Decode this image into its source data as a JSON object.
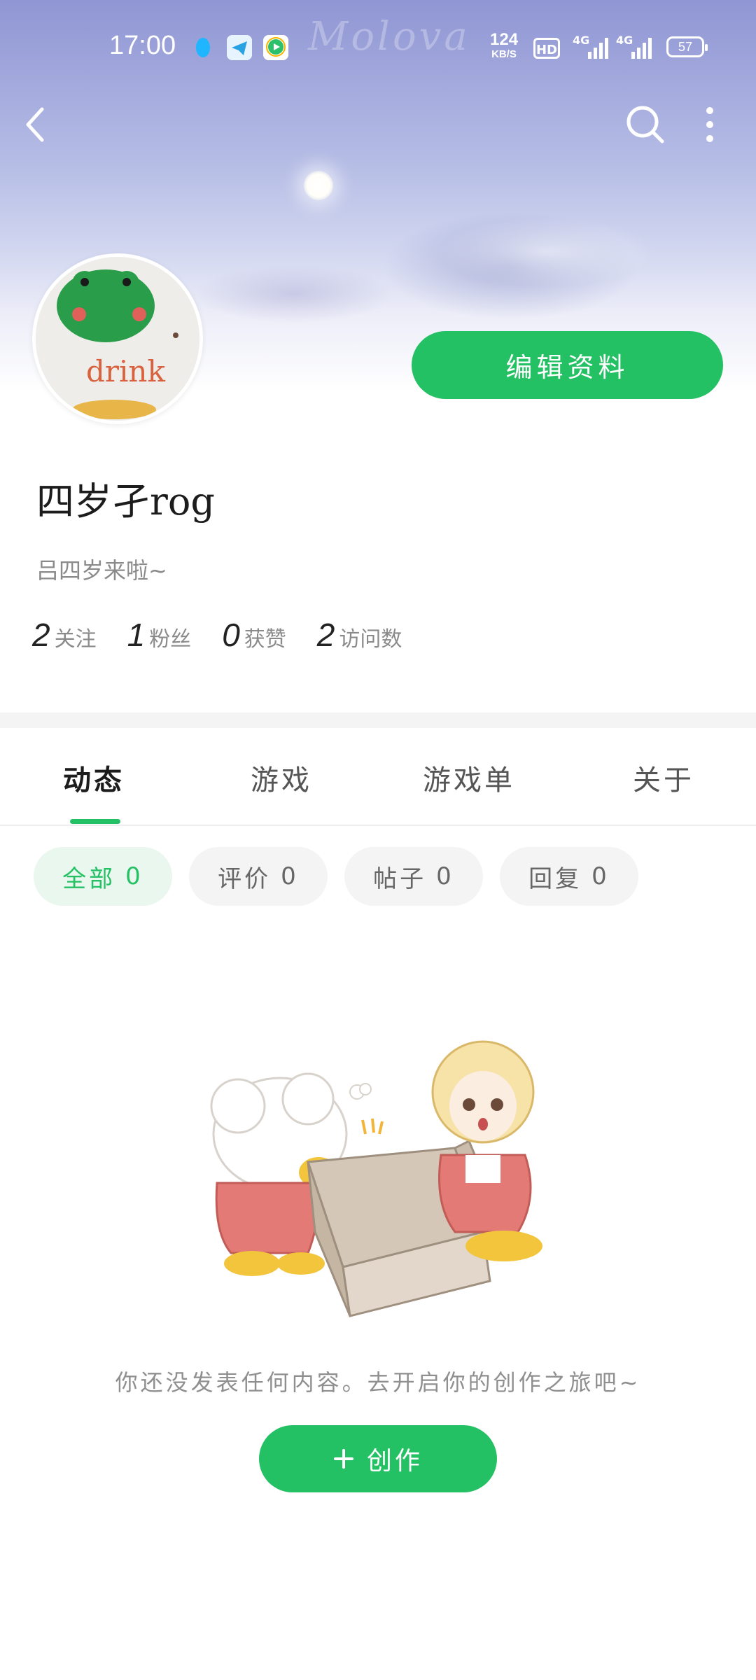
{
  "status_bar": {
    "time": "17:00",
    "net_speed_value": "124",
    "net_speed_unit": "KB/S",
    "hd_badge": "HD",
    "signal_1_label": "4G",
    "signal_2_label": "4G",
    "battery": "57",
    "icons": [
      "qq-icon",
      "telegram-icon",
      "video-app-icon"
    ]
  },
  "header": {
    "back_icon": "chevron-left-icon",
    "search_icon": "search-icon",
    "more_icon": "more-vertical-icon",
    "watermark": "Molova"
  },
  "profile": {
    "avatar_text": "drink",
    "edit_button": "编辑资料",
    "username": "四岁孑rog",
    "bio": "吕四岁来啦~",
    "stats": [
      {
        "num": "2",
        "label": "关注"
      },
      {
        "num": "1",
        "label": "粉丝"
      },
      {
        "num": "0",
        "label": "获赞"
      },
      {
        "num": "2",
        "label": "访问数"
      }
    ]
  },
  "tabs": [
    {
      "label": "动态",
      "active": true
    },
    {
      "label": "游戏",
      "active": false
    },
    {
      "label": "游戏单",
      "active": false
    },
    {
      "label": "关于",
      "active": false
    }
  ],
  "filters": [
    {
      "label": "全部",
      "count": "0",
      "active": true
    },
    {
      "label": "评价",
      "count": "0",
      "active": false
    },
    {
      "label": "帖子",
      "count": "0",
      "active": false
    },
    {
      "label": "回复",
      "count": "0",
      "active": false
    }
  ],
  "empty_state": {
    "message": "你还没发表任何内容。去开启你的创作之旅吧~",
    "create_button": "创作",
    "create_icon": "plus-icon"
  },
  "colors": {
    "accent": "#24c064",
    "accent_light": "#e9f7ef"
  }
}
